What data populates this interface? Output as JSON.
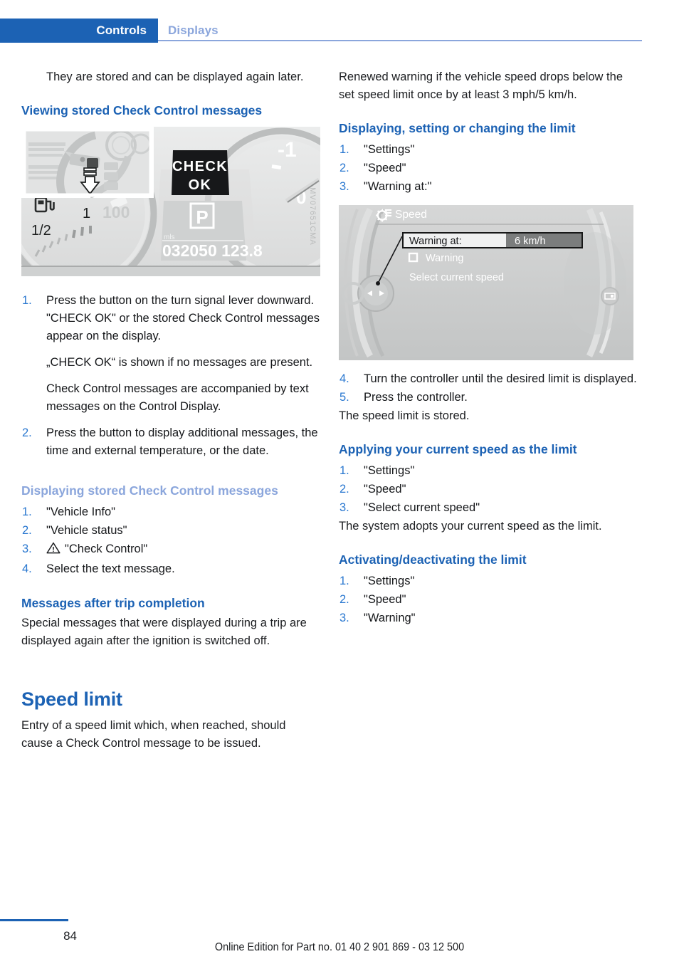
{
  "header": {
    "tab_active": "Controls",
    "tab_inactive": "Displays"
  },
  "left_column": {
    "intro_paragraph": "They are stored and can be displayed again later.",
    "heading_viewing": "Viewing stored Check Control messages",
    "figure_cluster": {
      "code": "MV07651CMA",
      "display_check": "CHECK",
      "display_ok": "OK",
      "gear_indicator": "P",
      "odometer_unit": "mls",
      "odometer": "032050",
      "trip": "123.8",
      "fuel_half": "1/2",
      "fuel_one": "1",
      "speed_tick": "100",
      "tach_minus_one": "-1",
      "tach_zero": "0"
    },
    "steps_viewing": [
      {
        "num": "1.",
        "text": "Press the button on the turn signal lever downward. \"CHECK OK\" or the stored Check Control messages appear on the display.",
        "subs": [
          "„CHECK OK“ is shown if no messages are present.",
          "Check Control messages are accompanied by text messages on the Control Display."
        ]
      },
      {
        "num": "2.",
        "text": "Press the button to display additional messages, the time and external temperature, or the date.",
        "subs": []
      }
    ],
    "heading_displaying": "Displaying stored Check Control messages",
    "steps_displaying": [
      {
        "num": "1.",
        "text": "\"Vehicle Info\"",
        "icon": ""
      },
      {
        "num": "2.",
        "text": "\"Vehicle status\"",
        "icon": ""
      },
      {
        "num": "3.",
        "text": "\"Check Control\"",
        "icon": "warning-triangle-icon"
      },
      {
        "num": "4.",
        "text": "Select the text message.",
        "icon": ""
      }
    ],
    "heading_trip": "Messages after trip completion",
    "trip_paragraph": "Special messages that were displayed during a trip are displayed again after the ignition is switched off.",
    "chapter_title": "Speed limit",
    "chapter_paragraph": "Entry of a speed limit which, when reached, should cause a Check Control message to be issued."
  },
  "right_column": {
    "renewed_paragraph": "Renewed warning if the vehicle speed drops below the set speed limit once by at least 3 mph/5 km/h.",
    "heading_displaying_limit": "Displaying, setting or changing the limit",
    "steps_displaying_limit": [
      {
        "num": "1.",
        "text": "\"Settings\""
      },
      {
        "num": "2.",
        "text": "\"Speed\""
      },
      {
        "num": "3.",
        "text": "\"Warning at:\""
      }
    ],
    "figure_idrive": {
      "menu_icon": "gear-icon",
      "menu_title": "Speed",
      "row_label": "Warning at:",
      "row_value": "6 km/h",
      "checkbox_label": "Warning",
      "checkbox_checked": false,
      "option_label": "Select current speed"
    },
    "steps_after_figure": [
      {
        "num": "4.",
        "text": "Turn the controller until the desired limit is displayed."
      },
      {
        "num": "5.",
        "text": "Press the controller."
      }
    ],
    "stored_paragraph": "The speed limit is stored.",
    "heading_applying": "Applying your current speed as the limit",
    "steps_applying": [
      {
        "num": "1.",
        "text": "\"Settings\""
      },
      {
        "num": "2.",
        "text": "\"Speed\""
      },
      {
        "num": "3.",
        "text": "\"Select current speed\""
      }
    ],
    "adopts_paragraph": "The system adopts your current speed as the limit.",
    "heading_activating": "Activating/deactivating the limit",
    "steps_activating": [
      {
        "num": "1.",
        "text": "\"Settings\""
      },
      {
        "num": "2.",
        "text": "\"Speed\""
      },
      {
        "num": "3.",
        "text": "\"Warning\""
      }
    ]
  },
  "footer": {
    "page_number": "84",
    "online_edition": "Online Edition for Part no. 01 40 2 901 869 - 03 12 500"
  },
  "colors": {
    "accent_blue": "#1c62b4",
    "light_blue": "#8ba6dc",
    "number_blue": "#2a78d0",
    "text": "#1b1d20"
  }
}
